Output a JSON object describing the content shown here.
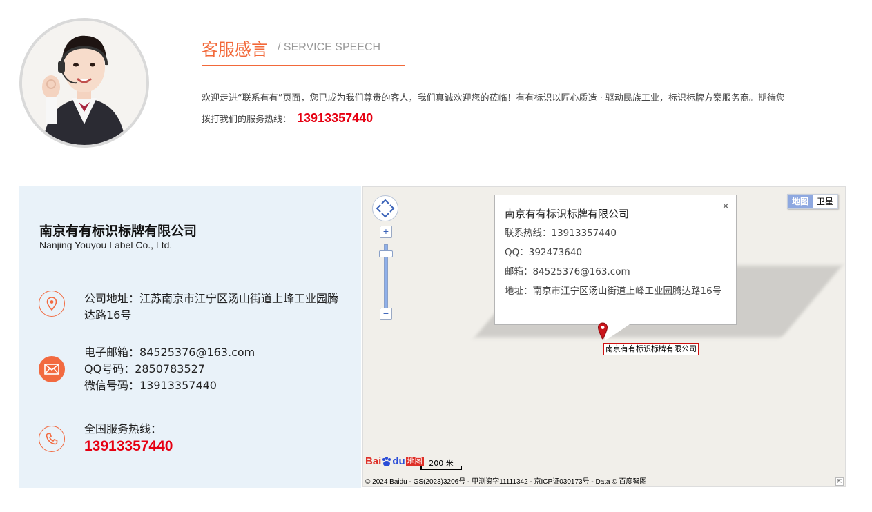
{
  "speech": {
    "title": "客服感言",
    "subtitle": "/ SERVICE SPEECH",
    "text_line1": "欢迎走进“联系有有”页面，您已成为我们尊贵的客人，我们真诚欢迎您的莅临！有有标识以匠心质造 · 驱动民族工业，标识标牌方案服务商。期待您",
    "text_line2": "拨打我们的服务热线：",
    "phone": "13913357440"
  },
  "contact": {
    "company_name": "南京有有标识标牌有限公司",
    "company_en": "Nanjing Youyou Label Co., Ltd.",
    "address_line1": "公司地址：江苏南京市江宁区汤山街道上峰工业园腾",
    "address_line2": "达路16号",
    "email": "电子邮箱：84525376@163.com",
    "qq": "QQ号码：2850783527",
    "wechat": "微信号码：13913357440",
    "hotline_label": "全国服务热线：",
    "hotline_number": "13913357440"
  },
  "map": {
    "type_map": "地图",
    "type_satellite": "卫星",
    "zoom_in": "+",
    "zoom_out": "−",
    "popup": {
      "title": "南京有有标识标牌有限公司",
      "phone": "联系热线：13913357440",
      "qq": "QQ：392473640",
      "email": "邮箱：84525376@163.com",
      "address": "地址：南京市江宁区汤山街道上峰工业园腾达路16号",
      "close": "×"
    },
    "marker_label": "南京有有标识标牌有限公司",
    "logo_bai": "Bai",
    "logo_du": "du",
    "logo_map": "地图",
    "scale": "200 米",
    "copyright": "© 2024 Baidu - GS(2023)3206号 - 甲测资字11111342 - 京ICP证030173号 - Data © 百度智图"
  },
  "colors": {
    "accent": "#f2693a",
    "hotline": "#e60012",
    "panel_bg": "#e9f2f9"
  }
}
